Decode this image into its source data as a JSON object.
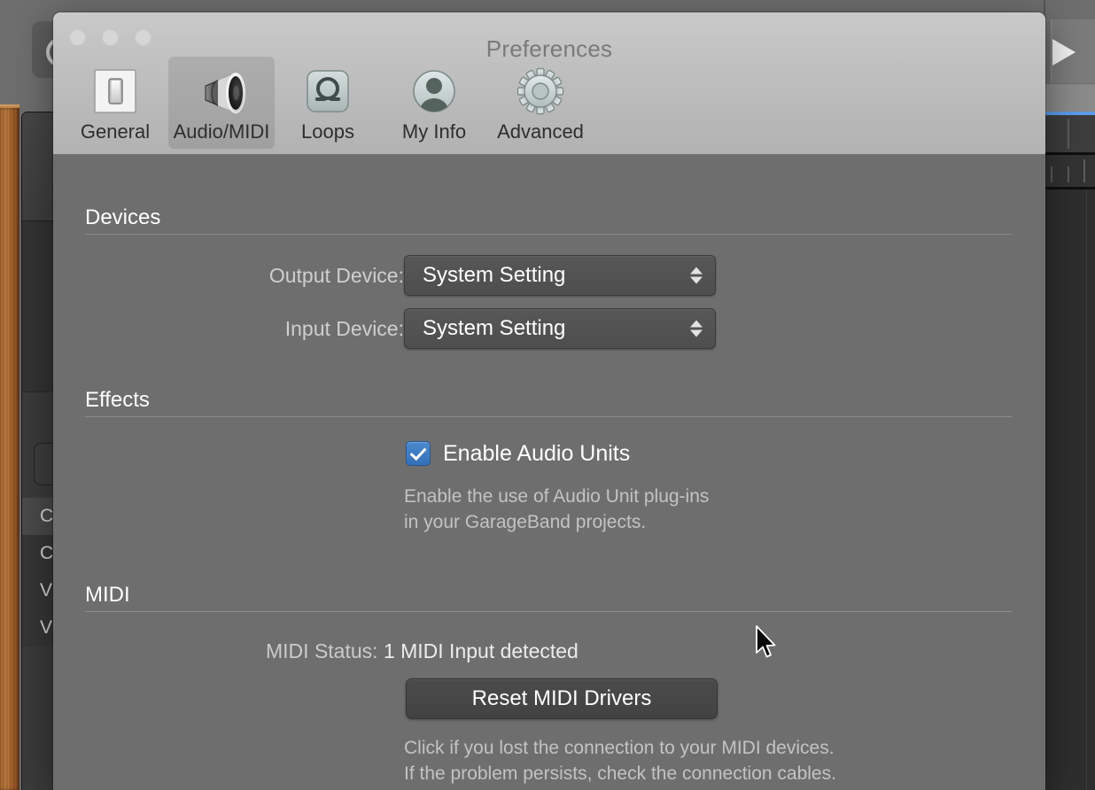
{
  "background_app": {
    "name": "GarageBand",
    "transport": {
      "play_icon": "play-triangle-icon"
    },
    "track_rows": [
      {
        "label": "C"
      },
      {
        "label": "C"
      },
      {
        "label": "V"
      },
      {
        "label": "V"
      }
    ]
  },
  "dialog": {
    "title": "Preferences",
    "window_controls": [
      {
        "name": "close",
        "state": "inactive"
      },
      {
        "name": "minimize",
        "state": "inactive"
      },
      {
        "name": "zoom",
        "state": "inactive"
      }
    ],
    "toolbar": {
      "items": [
        {
          "label": "General",
          "icon": "toggle-switch-icon",
          "selected": false
        },
        {
          "label": "Audio/MIDI",
          "icon": "speaker-icon",
          "selected": true
        },
        {
          "label": "Loops",
          "icon": "loop-omega-icon",
          "selected": false
        },
        {
          "label": "My Info",
          "icon": "person-avatar-icon",
          "selected": false
        },
        {
          "label": "Advanced",
          "icon": "gear-icon",
          "selected": false
        }
      ]
    },
    "sections": {
      "devices": {
        "title": "Devices",
        "output_label": "Output Device:",
        "output_value": "System Setting",
        "input_label": "Input Device:",
        "input_value": "System Setting"
      },
      "effects": {
        "title": "Effects",
        "checkbox_label": "Enable Audio Units",
        "checkbox_checked": true,
        "help_line1": "Enable the use of Audio Unit plug-ins",
        "help_line2": "in your GarageBand projects."
      },
      "midi": {
        "title": "MIDI",
        "status_label": "MIDI Status:",
        "status_value": "1 MIDI Input detected",
        "reset_button": "Reset MIDI Drivers",
        "help_line1": "Click if you lost the connection to your MIDI devices.",
        "help_line2": "If the problem persists, check the connection cables."
      }
    }
  },
  "colors": {
    "dialog_body": "#6e6e6e",
    "chrome": "#c2c2c2",
    "accent_checkbox": "#3B7DC4",
    "section_title": "#ffffff",
    "help_text": "#c3c3c3",
    "wood": "#a2622c",
    "playhead_blue": "#5b9bea"
  }
}
